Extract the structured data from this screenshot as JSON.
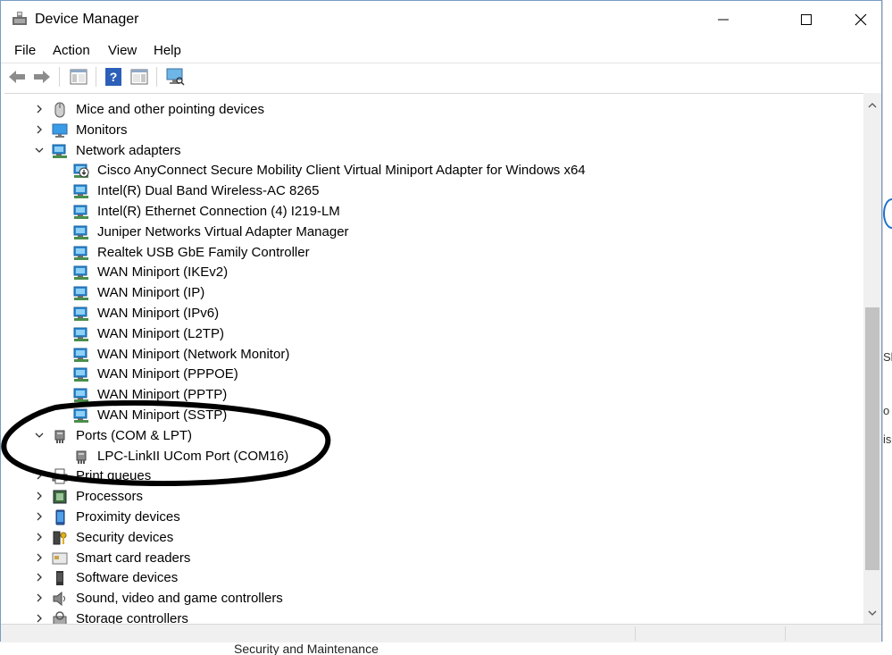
{
  "window": {
    "title": "Device Manager"
  },
  "menu": {
    "items": [
      "File",
      "Action",
      "View",
      "Help"
    ]
  },
  "toolbar": {
    "buttons": [
      "back-icon",
      "forward-icon",
      "show-hide-console-tree-icon",
      "help-icon",
      "properties-icon",
      "scan-hardware-icon"
    ]
  },
  "tree": {
    "rows": [
      {
        "label": "Mice and other pointing devices",
        "level": 0,
        "expanded": false,
        "icon": "mouse-icon"
      },
      {
        "label": "Monitors",
        "level": 0,
        "expanded": false,
        "icon": "monitor-icon"
      },
      {
        "label": "Network adapters",
        "level": 0,
        "expanded": true,
        "icon": "network-adapter-icon"
      },
      {
        "label": "Cisco AnyConnect Secure Mobility Client Virtual Miniport Adapter for Windows x64",
        "level": 1,
        "icon": "network-adapter-download-icon"
      },
      {
        "label": "Intel(R) Dual Band Wireless-AC 8265",
        "level": 1,
        "icon": "network-adapter-icon"
      },
      {
        "label": "Intel(R) Ethernet Connection (4) I219-LM",
        "level": 1,
        "icon": "network-adapter-icon"
      },
      {
        "label": "Juniper Networks Virtual Adapter Manager",
        "level": 1,
        "icon": "network-adapter-icon"
      },
      {
        "label": "Realtek USB GbE Family Controller",
        "level": 1,
        "icon": "network-adapter-icon"
      },
      {
        "label": "WAN Miniport (IKEv2)",
        "level": 1,
        "icon": "network-adapter-icon"
      },
      {
        "label": "WAN Miniport (IP)",
        "level": 1,
        "icon": "network-adapter-icon"
      },
      {
        "label": "WAN Miniport (IPv6)",
        "level": 1,
        "icon": "network-adapter-icon"
      },
      {
        "label": "WAN Miniport (L2TP)",
        "level": 1,
        "icon": "network-adapter-icon"
      },
      {
        "label": "WAN Miniport (Network Monitor)",
        "level": 1,
        "icon": "network-adapter-icon"
      },
      {
        "label": "WAN Miniport (PPPOE)",
        "level": 1,
        "icon": "network-adapter-icon"
      },
      {
        "label": "WAN Miniport (PPTP)",
        "level": 1,
        "icon": "network-adapter-icon"
      },
      {
        "label": "WAN Miniport (SSTP)",
        "level": 1,
        "icon": "network-adapter-icon"
      },
      {
        "label": "Ports (COM & LPT)",
        "level": 0,
        "expanded": true,
        "icon": "port-icon"
      },
      {
        "label": "LPC-LinkII UCom Port (COM16)",
        "level": 1,
        "icon": "port-icon"
      },
      {
        "label": "Print queues",
        "level": 0,
        "expanded": false,
        "icon": "printer-icon"
      },
      {
        "label": "Processors",
        "level": 0,
        "expanded": false,
        "icon": "processor-icon"
      },
      {
        "label": "Proximity devices",
        "level": 0,
        "expanded": false,
        "icon": "proximity-icon"
      },
      {
        "label": "Security devices",
        "level": 0,
        "expanded": false,
        "icon": "security-key-icon"
      },
      {
        "label": "Smart card readers",
        "level": 0,
        "expanded": false,
        "icon": "smart-card-icon"
      },
      {
        "label": "Software devices",
        "level": 0,
        "expanded": false,
        "icon": "software-device-icon"
      },
      {
        "label": "Sound, video and game controllers",
        "level": 0,
        "expanded": false,
        "icon": "speaker-icon"
      },
      {
        "label": "Storage controllers",
        "level": 0,
        "expanded": false,
        "icon": "storage-icon"
      }
    ]
  },
  "background": {
    "bottom_text": "Security and Maintenance",
    "edge_texts": [
      "Sh",
      "o",
      "is"
    ]
  },
  "colors": {
    "annotation": "#000000",
    "network_icon": "#2a8ad4",
    "scroll_thumb": "#c2c2c2"
  }
}
